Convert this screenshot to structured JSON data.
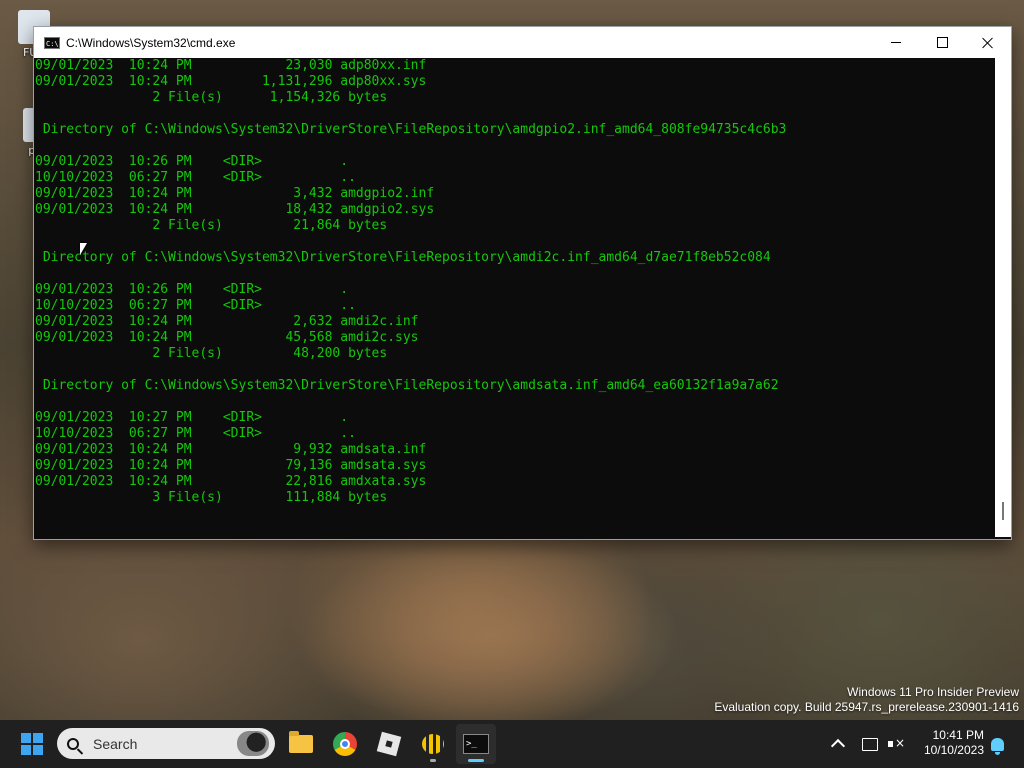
{
  "desktop": {
    "icons": [
      {
        "label": "FUC",
        "icon": "app-shortcut-icon"
      },
      {
        "label": "pr",
        "icon": "document-icon"
      }
    ],
    "watermark": {
      "line1": "Windows 11 Pro Insider Preview",
      "line2": "Evaluation copy. Build 25947.rs_prerelease.230901-1416"
    }
  },
  "window": {
    "title": "C:\\Windows\\System32\\cmd.exe",
    "icon": "cmd-icon",
    "icon_text": "C:\\",
    "buttons": [
      "minimize",
      "maximize",
      "close"
    ]
  },
  "console": {
    "text_color": "#16c60c",
    "background": "#0c0c0c",
    "lines": [
      "09/01/2023  10:24 PM            23,030 adp80xx.inf",
      "09/01/2023  10:24 PM         1,131,296 adp80xx.sys",
      "               2 File(s)      1,154,326 bytes",
      "",
      " Directory of C:\\Windows\\System32\\DriverStore\\FileRepository\\amdgpio2.inf_amd64_808fe94735c4c6b3",
      "",
      "09/01/2023  10:26 PM    <DIR>          .",
      "10/10/2023  06:27 PM    <DIR>          ..",
      "09/01/2023  10:24 PM             3,432 amdgpio2.inf",
      "09/01/2023  10:24 PM            18,432 amdgpio2.sys",
      "               2 File(s)         21,864 bytes",
      "",
      " Directory of C:\\Windows\\System32\\DriverStore\\FileRepository\\amdi2c.inf_amd64_d7ae71f8eb52c084",
      "",
      "09/01/2023  10:26 PM    <DIR>          .",
      "10/10/2023  06:27 PM    <DIR>          ..",
      "09/01/2023  10:24 PM             2,632 amdi2c.inf",
      "09/01/2023  10:24 PM            45,568 amdi2c.sys",
      "               2 File(s)         48,200 bytes",
      "",
      " Directory of C:\\Windows\\System32\\DriverStore\\FileRepository\\amdsata.inf_amd64_ea60132f1a9a7a62",
      "",
      "09/01/2023  10:27 PM    <DIR>          .",
      "10/10/2023  06:27 PM    <DIR>          ..",
      "09/01/2023  10:24 PM             9,932 amdsata.inf",
      "09/01/2023  10:24 PM            79,136 amdsata.sys",
      "09/01/2023  10:24 PM            22,816 amdxata.sys",
      "               3 File(s)        111,884 bytes"
    ]
  },
  "taskbar": {
    "search_placeholder": "Search",
    "apps": [
      {
        "name": "start",
        "icon": "windows-start-icon"
      },
      {
        "name": "file-explorer",
        "icon": "folder-icon"
      },
      {
        "name": "chrome",
        "icon": "chrome-icon"
      },
      {
        "name": "roblox",
        "icon": "roblox-icon"
      },
      {
        "name": "bee-app",
        "icon": "bee-icon"
      },
      {
        "name": "command-prompt",
        "icon": "terminal-icon",
        "active": true
      }
    ],
    "tray": {
      "time": "10:41 PM",
      "date": "10/10/2023",
      "accent": "#60cdff"
    }
  }
}
